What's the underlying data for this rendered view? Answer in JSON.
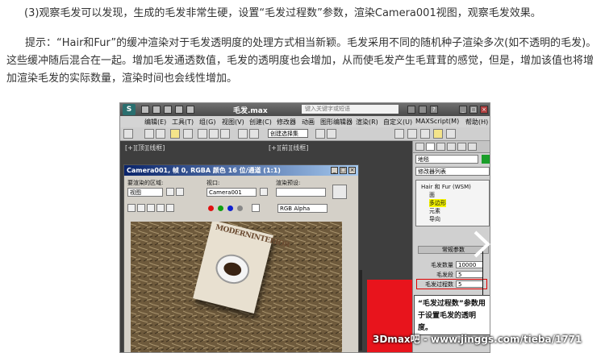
{
  "article": {
    "step_text": "(3)观察毛发可以发现，生成的毛发非常生硬，设置“毛发过程数”参数，渲染Camera001视图，观察毛发效果。",
    "tip_text": "提示：“Hair和Fur”的缓冲渲染对于毛发透明度的处理方式相当新颖。毛发采用不同的随机种子渲染多次(如不透明的毛发)。这些缓冲随后混合在一起。增加毛发通透数值，毛发的透明度也会增加，从而使毛发产生毛茸茸的感觉，但是，增加该值也将增加渲染毛发的实际数量，渲染时间也会线性增加。"
  },
  "app": {
    "logo": "S",
    "title": "毛发.max",
    "search_placeholder": "键入关键字或短语",
    "menu": [
      "编辑(E)",
      "工具(T)",
      "组(G)",
      "视图(V)",
      "创建(C)",
      "修改器",
      "动画",
      "图形编辑器",
      "渲染(R)",
      "自定义(U)",
      "MAXScript(M)",
      "帮助(H)"
    ],
    "toolbar_dropdown": "创建选择集"
  },
  "command_panel": {
    "object_name": "地毯",
    "modifier_list": "修改器列表",
    "stack": [
      "Hair 和 Fur (WSM)",
      "面",
      "多边形",
      "元素",
      "导向"
    ],
    "stack_selected": 2,
    "rollout_title": "常规参数",
    "params": [
      {
        "label": "毛发数量",
        "value": "10000"
      },
      {
        "label": "毛发段",
        "value": "5"
      },
      {
        "label": "毛发过程数",
        "value": "5"
      }
    ],
    "callout": "“毛发过程数”参数用于设置毛发的透明度。"
  },
  "render_window": {
    "title": "Camera001, 帧 0, RGBA 颜色 16 位/通道 (1:1)",
    "area_label": "要渲染的区域:",
    "area_value": "视图",
    "viewport_label": "视口:",
    "viewport_value": "Camera001",
    "preset_label": "渲染预设:",
    "preset_value": "",
    "channel_value": "RGB Alpha",
    "image_book_title": "MODERNINTERIOR"
  },
  "watermark": "3Dmax吧 - www.jinggs.com/tieba/1771",
  "colors": {
    "selection_highlight": "#f6f600",
    "callout_border": "#e00000",
    "object_color": "#1a9e2a"
  }
}
